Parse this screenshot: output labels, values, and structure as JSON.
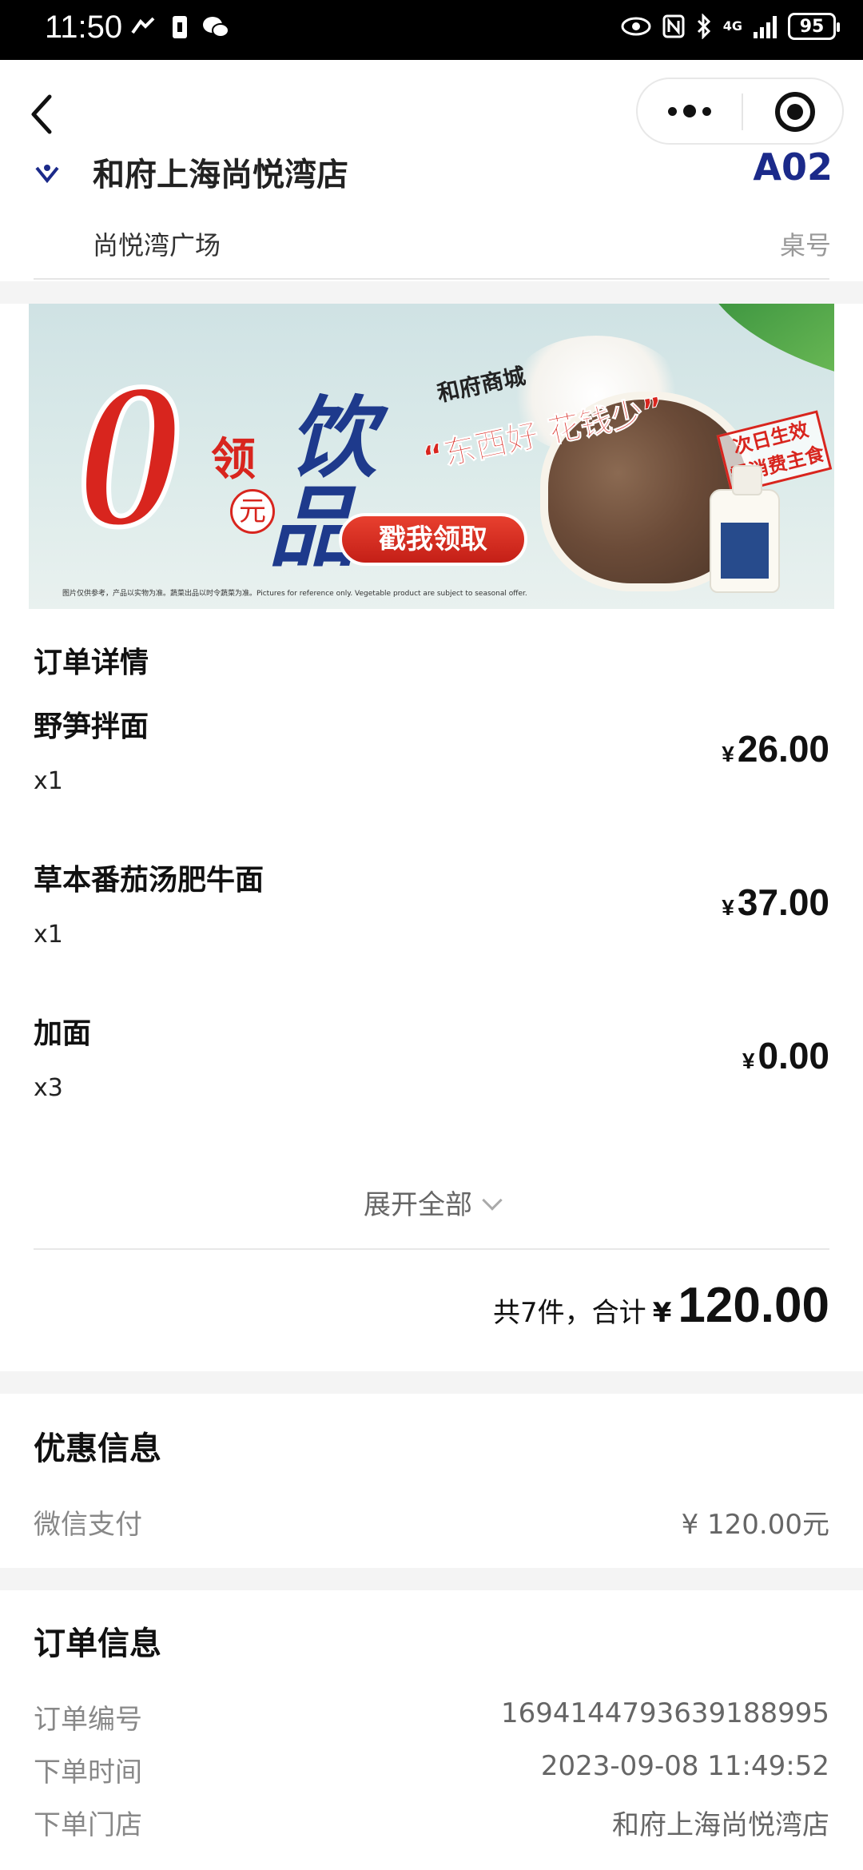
{
  "status_bar": {
    "time": "11:50",
    "battery": "95",
    "network": "4G",
    "icons": [
      "signal-icon",
      "sim-icon",
      "wechat-icon",
      "eye-icon",
      "nfc-icon",
      "bluetooth-icon",
      "battery-icon"
    ]
  },
  "nav": {
    "back_icon": "chevron-left-icon",
    "more_icon": "more-dots-icon",
    "close_icon": "target-circle-icon"
  },
  "store": {
    "name": "和府上海尚悦湾店",
    "sub": "尚悦湾广场",
    "table_no": "A02",
    "table_label": "桌号"
  },
  "banner": {
    "zero": "0",
    "ling": "领",
    "yuan": "元",
    "yin": "饮",
    "pin": "品",
    "brand": "和府商城",
    "slogan": "“东西好 花钱少”",
    "cta": "戳我领取",
    "stamp": "次日生效 需消费主食",
    "disclaimer": "图片仅供参考，产品以实物为准。蔬菜出品以时令蔬菜为准。Pictures for reference only. Vegetable product are subject to seasonal offer."
  },
  "order": {
    "title": "订单详情",
    "currency": "¥",
    "items": [
      {
        "name": "野笋拌面",
        "qty": "x1",
        "price": "26.00"
      },
      {
        "name": "草本番茄汤肥牛面",
        "qty": "x1",
        "price": "37.00"
      },
      {
        "name": "加面",
        "qty": "x3",
        "price": "0.00"
      }
    ],
    "expand_label": "展开全部",
    "total_text": "共7件，合计",
    "total_amount": "120.00"
  },
  "discount": {
    "title": "优惠信息",
    "label": "微信支付",
    "value": "¥ 120.00元"
  },
  "order_info": {
    "title": "订单信息",
    "rows": [
      {
        "k": "订单编号",
        "v": "1694144793639188995"
      },
      {
        "k": "下单时间",
        "v": "2023-09-08 11:49:52"
      },
      {
        "k": "下单门店",
        "v": "和府上海尚悦湾店"
      }
    ]
  }
}
